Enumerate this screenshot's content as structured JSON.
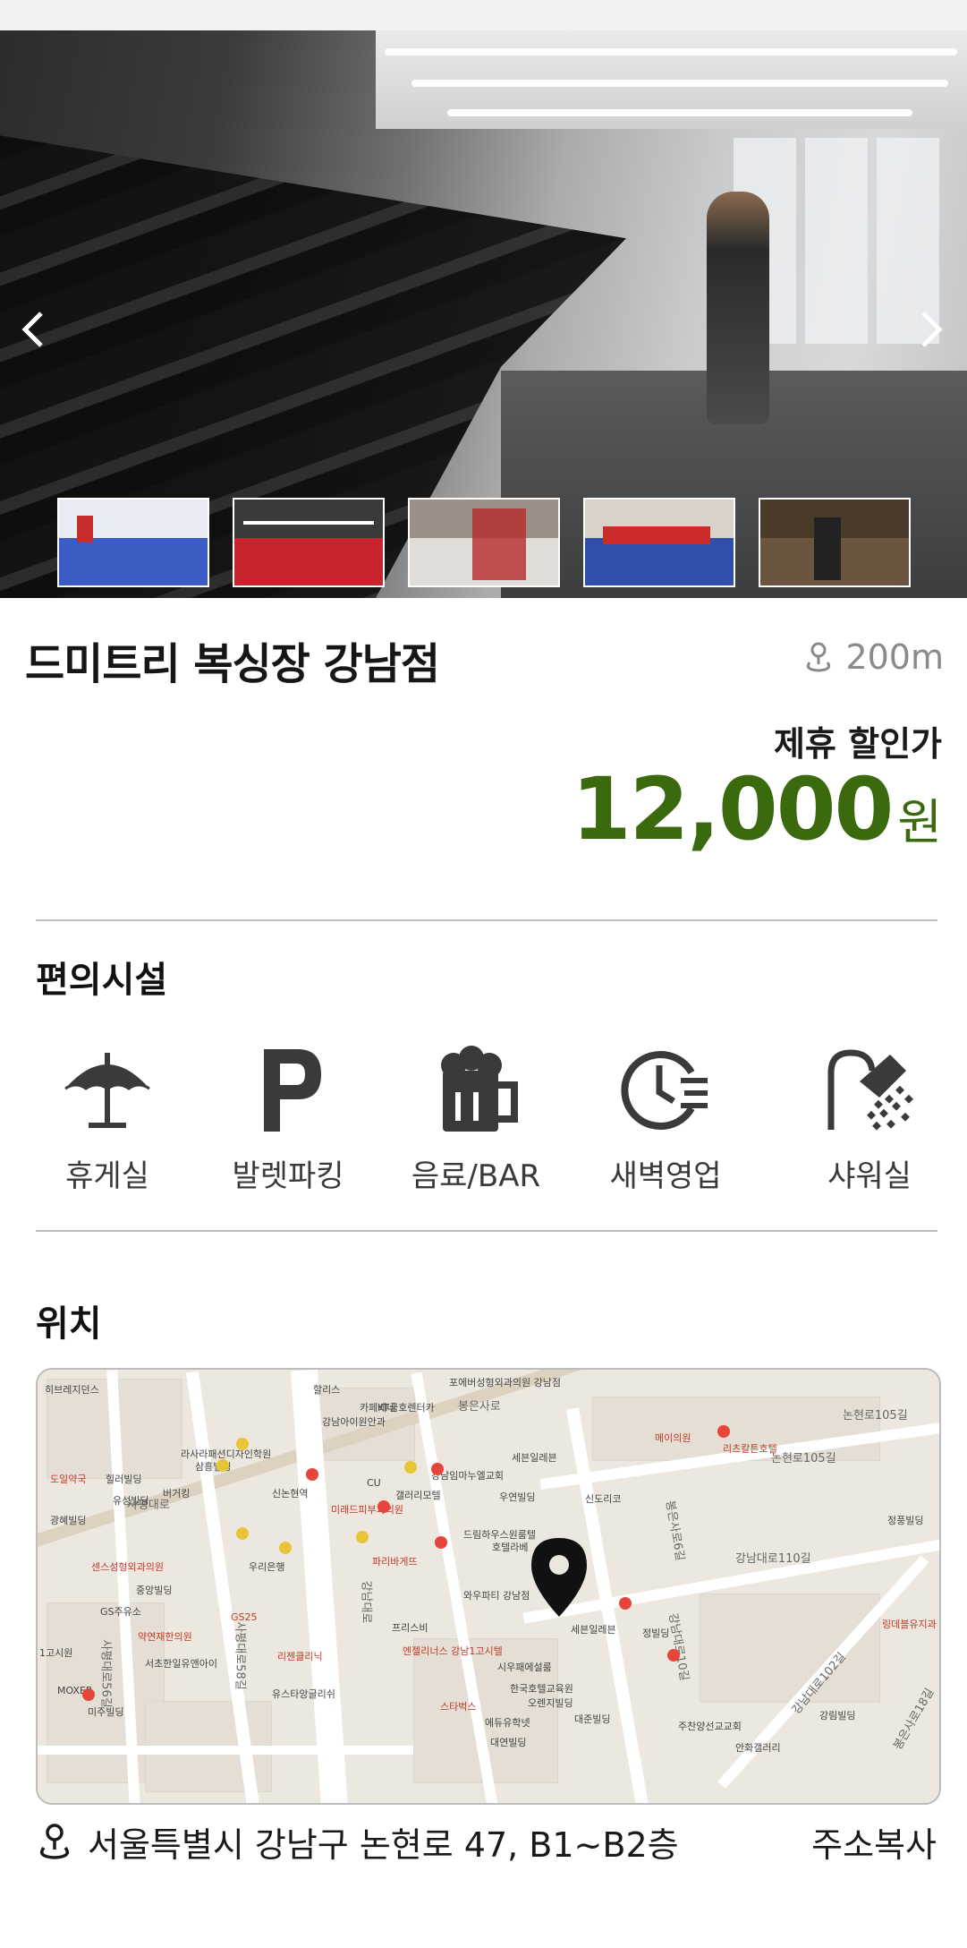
{
  "gallery": {
    "prev_icon": "chevron-left-icon",
    "next_icon": "chevron-right-icon",
    "thumbnail_count": 5
  },
  "gym": {
    "name": "드미트리 복싱장 강남점",
    "distance": "200m",
    "discount_label": "제휴 할인가",
    "price": "12,000",
    "price_unit": "원",
    "price_color": "#3b6a0e"
  },
  "amenities": {
    "title": "편의시설",
    "items": [
      {
        "icon": "umbrella-icon",
        "label": "휴게실"
      },
      {
        "icon": "parking-icon",
        "label": "발렛파킹"
      },
      {
        "icon": "beer-icon",
        "label": "음료/BAR"
      },
      {
        "icon": "clock-icon",
        "label": "새벽영업"
      },
      {
        "icon": "shower-icon",
        "label": "샤워실"
      }
    ]
  },
  "location": {
    "title": "위치",
    "address": "서울특별시 강남구 논현로 47, B1~B2층",
    "copy_label": "주소복사",
    "map_labels": {
      "station": "신논현역",
      "road1": "봉은사로",
      "road2": "논현로105길",
      "road3": "강남대로110길",
      "road4": "사평대로",
      "road5": "강남대로",
      "road6": "사평대로56길",
      "road7": "사평대로58길",
      "road8": "봉은사로6길",
      "road9": "강남대로10길",
      "road10": "강남대로102길",
      "road11": "봉은사로18길",
      "road12": "논현로105길",
      "p1": "KT금호렌터카",
      "p2": "강남아이원안과",
      "p3": "라사라패션디자인학원",
      "p4": "삼흥빌딩",
      "p5": "도일약국",
      "p6": "힐러빌딩",
      "p7": "유성빌딩",
      "p8": "광혜빌딩",
      "p9": "버거킹",
      "p10": "센스성형외과의원",
      "p11": "중앙빌딩",
      "p12": "GS주유소",
      "p13": "우리은행",
      "p14": "약연재한의원",
      "p15": "서초한일유앤아이",
      "p16": "리젠클리닉",
      "p17": "유스타앙글리쉬",
      "p18": "미주빌딩",
      "p19": "파리바게뜨",
      "p20": "미래드피부과의원",
      "p21": "갤러리모텔",
      "p22": "강남임마누엘교회",
      "p23": "세븐일레븐",
      "p24": "우연빌딩",
      "p25": "신도리코",
      "p26": "호텔라베",
      "p27": "와우파티 강남점",
      "p28": "세븐일레븐",
      "p29": "정빌딩",
      "p30": "프리스비",
      "p31": "엔젤리너스 강남1고시텔",
      "p32": "시우패에설룸",
      "p33": "한국호텔교육원",
      "p34": "오렌지빌딩",
      "p35": "스타벅스",
      "p36": "에듀유학넷",
      "p37": "대연빌딩",
      "p38": "대준빌딩",
      "p39": "주찬양선교교회",
      "p40": "안화갤러리",
      "p41": "메이의원",
      "p42": "리츠칼튼호텔",
      "p43": "정풍빌딩",
      "p44": "링데블유지과",
      "p45": "강림빌딩",
      "p46": "카페베네",
      "p47": "할리스",
      "p48": "포에버성형외과의원 강남점",
      "p49": "히브레지던스",
      "p50": "MOXEP",
      "p51": "1고시원",
      "p52": "사평대로",
      "p53": "드림하우스원룸텔",
      "p54": "GS25",
      "p55": "CU"
    }
  }
}
